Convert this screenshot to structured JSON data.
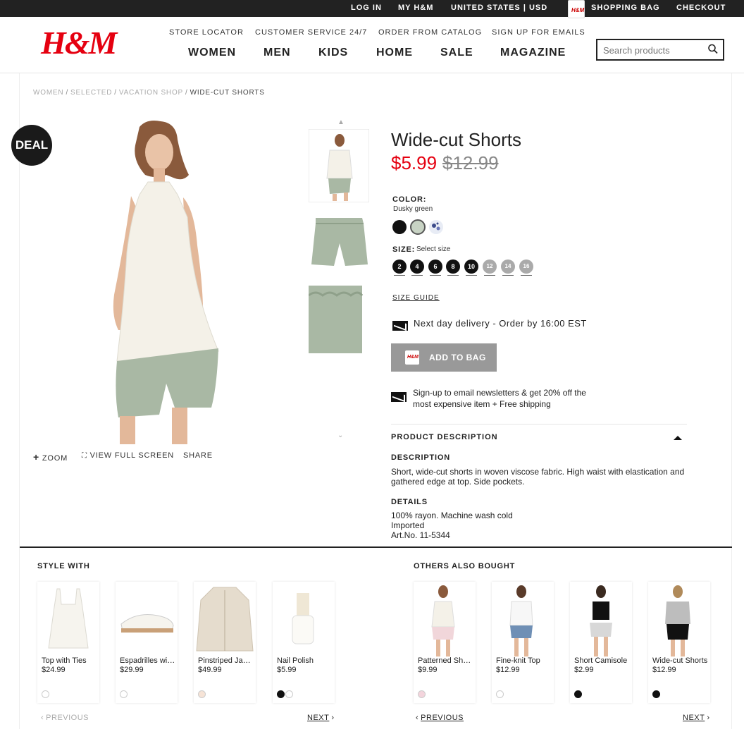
{
  "topbar": {
    "login": "LOG IN",
    "my_hm": "MY H&M",
    "region": "UNITED STATES | USD",
    "bag_icon_label": "H&M",
    "bag": "SHOPPING BAG",
    "checkout": "CHECKOUT"
  },
  "header": {
    "logo": "H&M",
    "subnav": [
      "STORE LOCATOR",
      "CUSTOMER SERVICE 24/7",
      "ORDER FROM CATALOG",
      "SIGN UP FOR EMAILS"
    ],
    "mainnav": [
      "WOMEN",
      "MEN",
      "KIDS",
      "HOME",
      "SALE",
      "MAGAZINE"
    ],
    "search_placeholder": "Search products"
  },
  "breadcrumb": [
    "WOMEN",
    "SELECTED",
    "VACATION SHOP",
    "WIDE-CUT SHORTS"
  ],
  "badge": "DEAL",
  "image_tools": {
    "zoom": "ZOOM",
    "fullscreen": "VIEW FULL SCREEN",
    "share": "SHARE"
  },
  "product": {
    "title": "Wide-cut Shorts",
    "price": "$5.99",
    "old_price": "$12.99",
    "color_label": "COLOR:",
    "color_value": "Dusky green",
    "swatches": [
      "#111111",
      "#c8d3c4",
      "#e8ecf5"
    ],
    "size_label": "SIZE:",
    "size_hint": "Select size",
    "sizes": [
      {
        "label": "2",
        "available": true
      },
      {
        "label": "4",
        "available": true
      },
      {
        "label": "6",
        "available": true
      },
      {
        "label": "8",
        "available": true
      },
      {
        "label": "10",
        "available": true
      },
      {
        "label": "12",
        "available": false
      },
      {
        "label": "14",
        "available": false
      },
      {
        "label": "16",
        "available": false
      }
    ],
    "size_guide": "SIZE GUIDE",
    "delivery": "Next day delivery - Order by 16:00 EST",
    "add_to_bag": "ADD TO BAG",
    "add_to_bag_icon_label": "H&M",
    "newsletter": "Sign-up to email newsletters & get 20% off the most expensive item + Free shipping",
    "desc_heading": "PRODUCT DESCRIPTION",
    "desc_label": "DESCRIPTION",
    "description": "Short, wide-cut shorts in woven viscose fabric. High waist with elastication and gathered edge at top. Side pockets.",
    "details_label": "DETAILS",
    "details": [
      "100% rayon. Machine wash cold",
      "Imported",
      "Art.No. 11-5344"
    ]
  },
  "style_with": {
    "heading": "STYLE WITH",
    "items": [
      {
        "name": "Top with Ties",
        "price": "$24.99",
        "dots": [
          "#ffffff"
        ]
      },
      {
        "name": "Espadrilles with...",
        "price": "$29.99",
        "dots": [
          "#ffffff"
        ]
      },
      {
        "name": "Pinstriped Jacket",
        "price": "$49.99",
        "dots": [
          "#f6e3d6"
        ]
      },
      {
        "name": "Nail Polish",
        "price": "$5.99",
        "dots": [
          "#111111",
          "#ffffff"
        ]
      }
    ],
    "prev": "PREVIOUS",
    "next": "NEXT"
  },
  "others_bought": {
    "heading": "OTHERS ALSO BOUGHT",
    "items": [
      {
        "name": "Patterned Shorts",
        "price": "$9.99",
        "dots": [
          "#f3d4dc"
        ]
      },
      {
        "name": "Fine-knit Top",
        "price": "$12.99",
        "dots": [
          "#ffffff"
        ]
      },
      {
        "name": "Short Camisole",
        "price": "$2.99",
        "dots": [
          "#111111"
        ]
      },
      {
        "name": "Wide-cut Shorts",
        "price": "$12.99",
        "dots": [
          "#111111"
        ]
      }
    ],
    "prev": "PREVIOUS",
    "next": "NEXT"
  },
  "colors": {
    "brand": "#e50010",
    "dark": "#222222",
    "button": "#999999"
  }
}
